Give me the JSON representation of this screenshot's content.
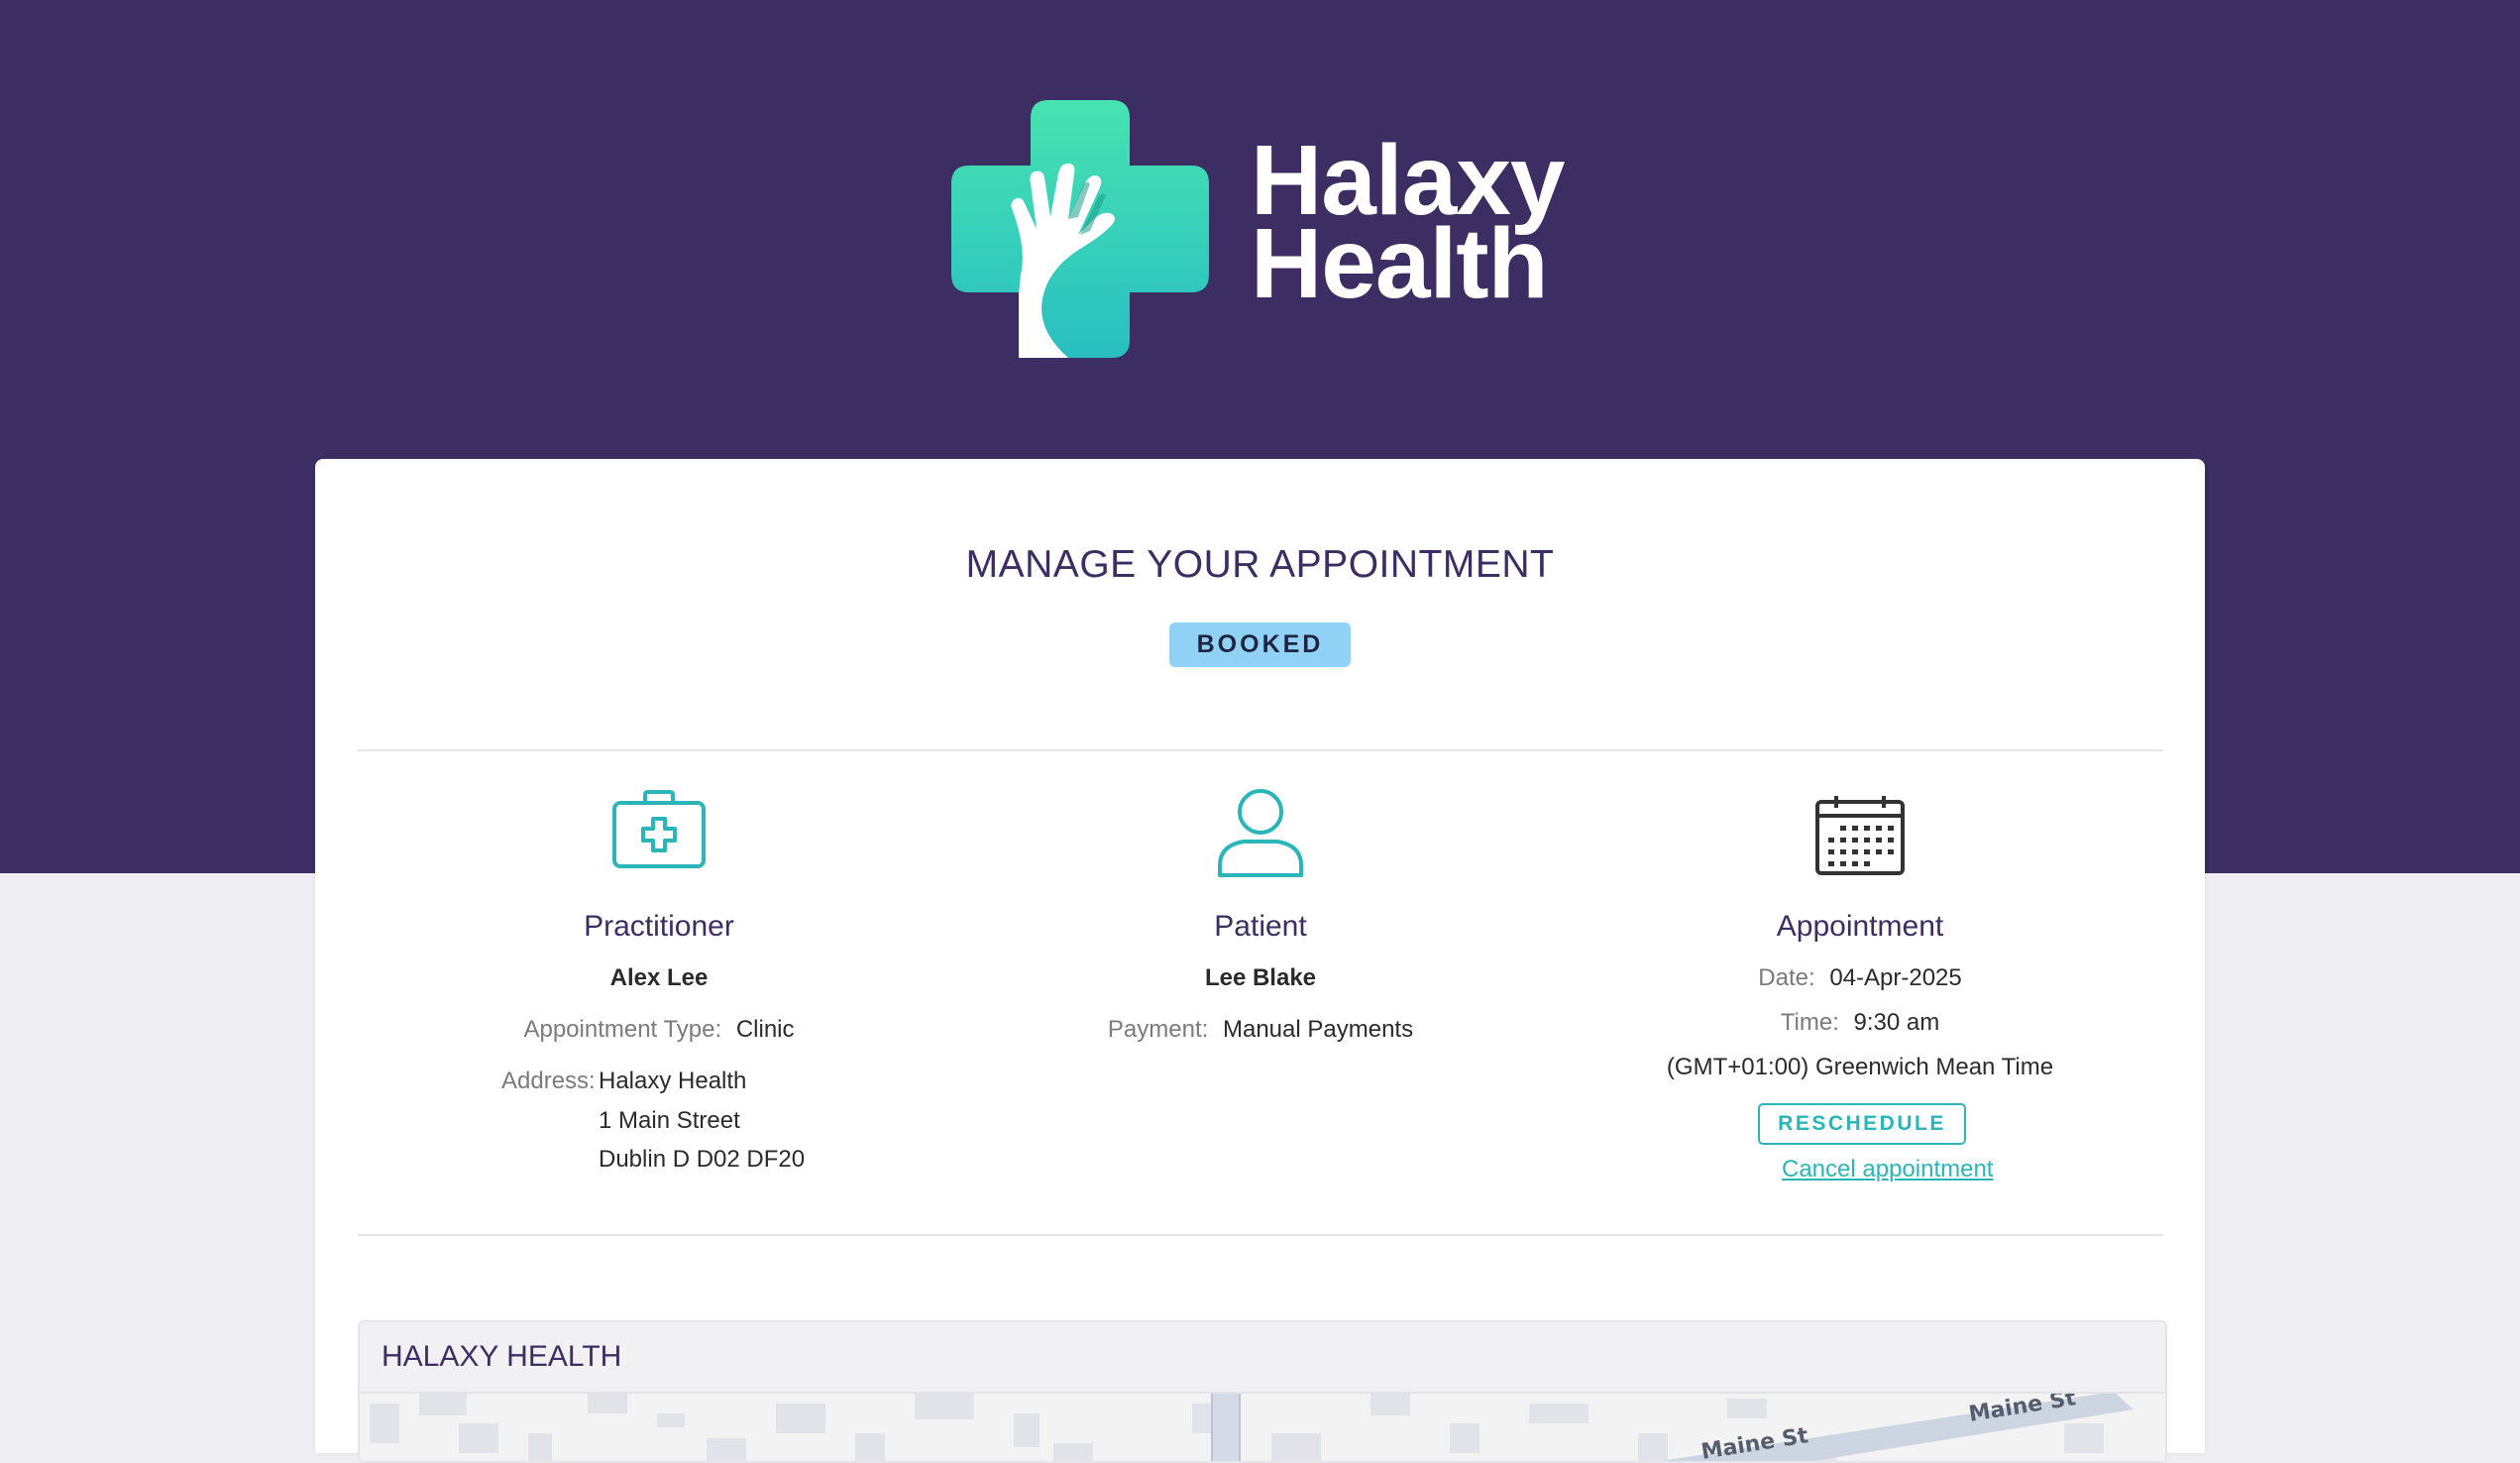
{
  "brand": {
    "line1": "Halaxy",
    "line2": "Health"
  },
  "page": {
    "title": "MANAGE YOUR APPOINTMENT",
    "status_badge": "BOOKED"
  },
  "practitioner": {
    "heading": "Practitioner",
    "name": "Alex Lee",
    "appointment_type_label": "Appointment Type:",
    "appointment_type": "Clinic",
    "address_label": "Address:",
    "address_lines": [
      "Halaxy Health",
      "1 Main Street",
      "Dublin D D02 DF20"
    ]
  },
  "patient": {
    "heading": "Patient",
    "name": "Lee Blake",
    "payment_label": "Payment:",
    "payment": "Manual Payments"
  },
  "appointment": {
    "heading": "Appointment",
    "date_label": "Date:",
    "date": "04-Apr-2025",
    "time_label": "Time:",
    "time": "9:30 am",
    "timezone": "(GMT+01:00) Greenwich Mean Time",
    "reschedule_label": "RESCHEDULE",
    "cancel_label": "Cancel appointment"
  },
  "map": {
    "title": "HALAXY HEALTH",
    "street_labels": [
      "Maine St",
      "Maine St"
    ]
  },
  "colors": {
    "header_bg": "#3c2d63",
    "accent": "#2ab6b8",
    "badge_bg": "#8fd2f5",
    "page_bg": "#efeff3"
  }
}
